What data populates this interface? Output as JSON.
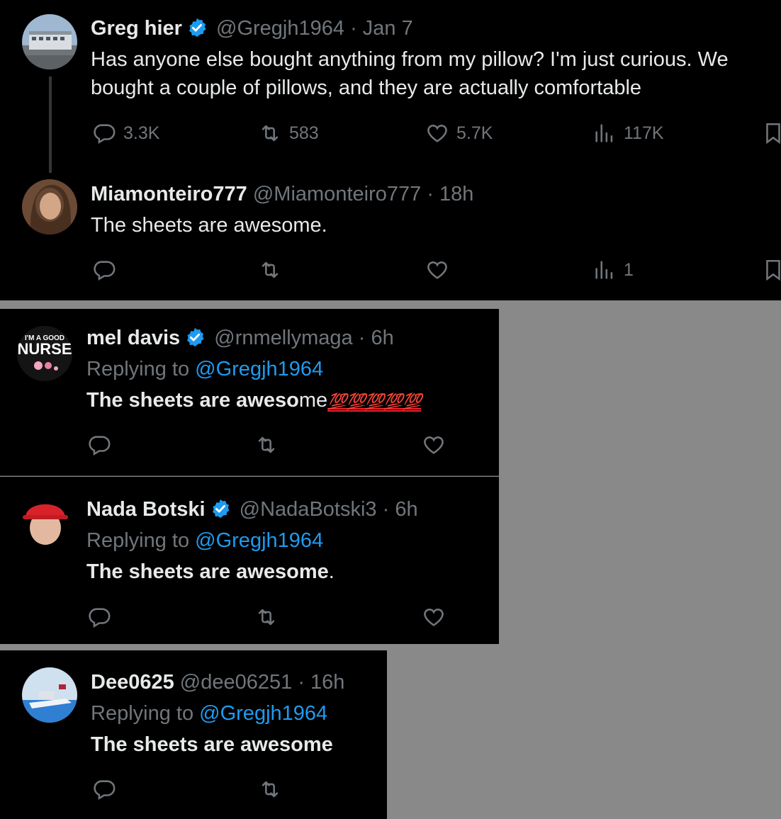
{
  "tweet_main": {
    "name": "Greg hier",
    "handle": "@Gregjh1964",
    "separator": "·",
    "time": "Jan 7",
    "text": "Has anyone else bought anything from my pillow? I'm just curious. We bought a couple of pillows, and they are actually comfortable",
    "replies": "3.3K",
    "retweets": "583",
    "likes": "5.7K",
    "views": "117K"
  },
  "reply_mia": {
    "name": "Miamonteiro777",
    "handle": "@Miamonteiro777",
    "separator": "·",
    "time": "18h",
    "text": "The sheets are awesome.",
    "views": "1"
  },
  "reply_mel": {
    "name": "mel davis",
    "handle": "@rnmellymaga",
    "separator": "·",
    "time": "6h",
    "replying_prefix": "Replying to ",
    "replying_to": "@Gregjh1964",
    "text_bold": "The sheets are aweso",
    "text_normal": "me",
    "emoji": "💯💯💯💯💯",
    "avatar_text_top": "I'M A GOOD",
    "avatar_text_main": "NURSE"
  },
  "reply_nada": {
    "name": "Nada Botski",
    "handle": "@NadaBotski3",
    "separator": "·",
    "time": "6h",
    "replying_prefix": "Replying to ",
    "replying_to": "@Gregjh1964",
    "text_bold": "The sheets are awesome",
    "text_normal": "."
  },
  "reply_dee": {
    "name": "Dee0625",
    "handle": "@dee06251",
    "separator": "·",
    "time": "16h",
    "replying_prefix": "Replying to ",
    "replying_to": "@Gregjh1964",
    "text_bold": "The sheets are awesome"
  },
  "colors": {
    "background": "#000000",
    "gap": "#898989",
    "text": "#e7e9ea",
    "muted": "#71767b",
    "link": "#1d9bf0",
    "verified": "#1d9bf0"
  },
  "icons": [
    "reply-icon",
    "retweet-icon",
    "like-icon",
    "views-icon",
    "bookmark-icon",
    "verified-badge-icon"
  ]
}
